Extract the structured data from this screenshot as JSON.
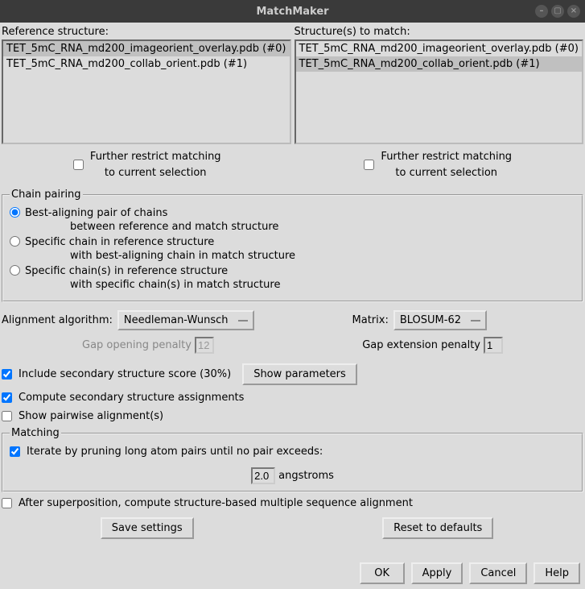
{
  "window": {
    "title": "MatchMaker"
  },
  "reference": {
    "label": "Reference structure:",
    "items": [
      {
        "text": "TET_5mC_RNA_md200_imageorient_overlay.pdb (#0)",
        "selected": true
      },
      {
        "text": "TET_5mC_RNA_md200_collab_orient.pdb (#1)",
        "selected": false
      }
    ]
  },
  "match": {
    "label": "Structure(s) to match:",
    "items": [
      {
        "text": "TET_5mC_RNA_md200_imageorient_overlay.pdb (#0)",
        "selected": false
      },
      {
        "text": "TET_5mC_RNA_md200_collab_orient.pdb (#1)",
        "selected": true
      }
    ]
  },
  "restrict": {
    "line1": "Further restrict matching",
    "line2": "to current selection"
  },
  "chain_pairing": {
    "legend": "Chain pairing",
    "options": [
      {
        "line1": "Best-aligning pair of chains",
        "line2": "between reference and match structure",
        "checked": true
      },
      {
        "line1": "Specific chain in reference structure",
        "line2": "with best-aligning chain in match structure",
        "checked": false
      },
      {
        "line1": "Specific chain(s) in reference structure",
        "line2": "with specific chain(s) in match structure",
        "checked": false
      }
    ]
  },
  "algorithm": {
    "label": "Alignment algorithm:",
    "value": "Needleman-Wunsch",
    "matrix_label": "Matrix:",
    "matrix_value": "BLOSUM-62"
  },
  "penalties": {
    "gap_open_label": "Gap opening penalty",
    "gap_open_value": "12",
    "gap_ext_label": "Gap extension penalty",
    "gap_ext_value": "1"
  },
  "checks": {
    "include_ss": "Include secondary structure score (30%)",
    "show_params": "Show parameters",
    "compute_ss": "Compute secondary structure assignments",
    "show_pairwise": "Show pairwise alignment(s)"
  },
  "matching": {
    "legend": "Matching",
    "iterate": "Iterate by pruning long atom pairs until no pair exceeds:",
    "value": "2.0",
    "unit": "angstroms"
  },
  "after_superposition": "After superposition, compute structure-based multiple sequence alignment",
  "buttons": {
    "save": "Save settings",
    "reset": "Reset to defaults",
    "ok": "OK",
    "apply": "Apply",
    "cancel": "Cancel",
    "help": "Help"
  }
}
